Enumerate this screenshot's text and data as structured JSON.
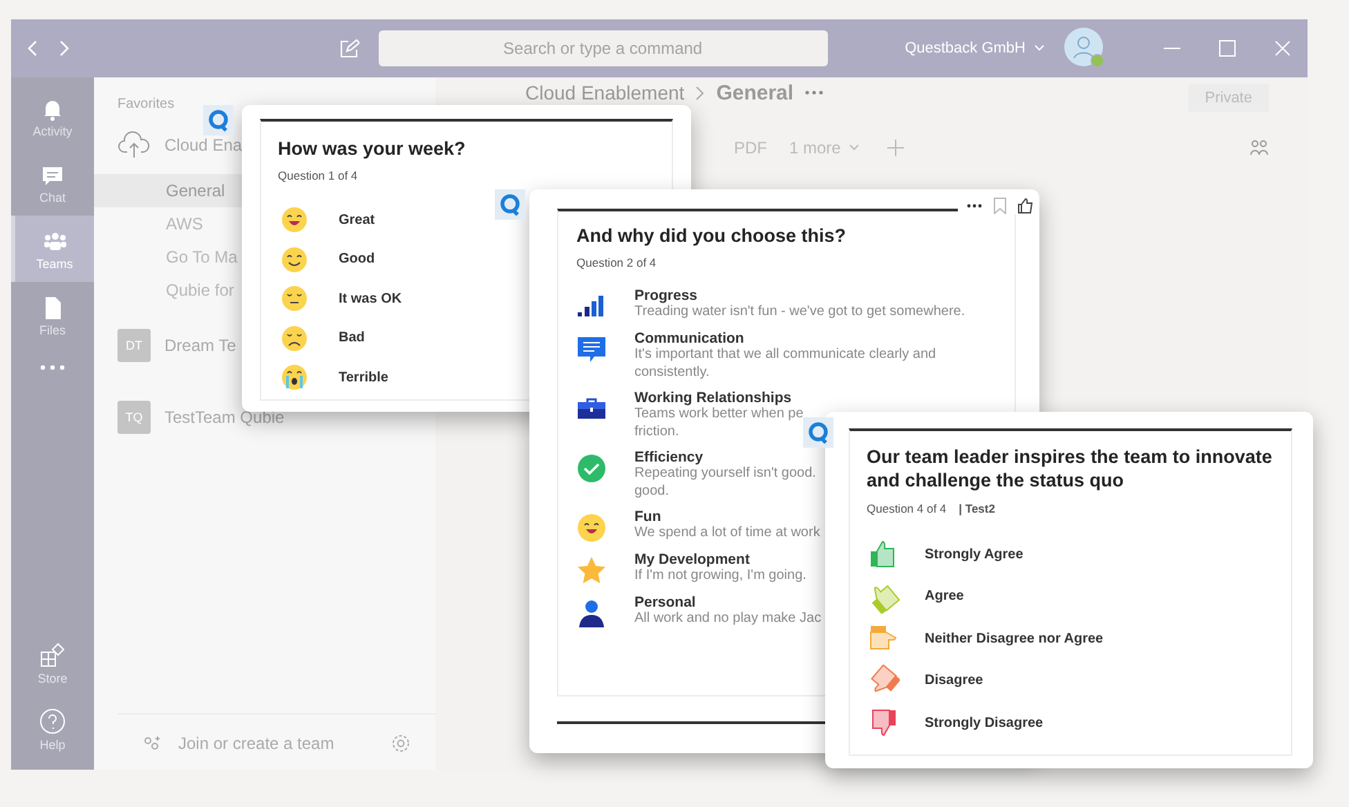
{
  "titlebar": {
    "search": {
      "placeholder": "Search or type a command"
    },
    "org": "Questback GmbH"
  },
  "rail": [
    {
      "label": "Activity",
      "kind": "bell",
      "selected": false
    },
    {
      "label": "Chat",
      "kind": "chat",
      "selected": false
    },
    {
      "label": "Teams",
      "kind": "teams",
      "selected": true
    },
    {
      "label": "Files",
      "kind": "file",
      "selected": false
    }
  ],
  "rail_bottom": [
    {
      "label": "Store",
      "kind": "store"
    },
    {
      "label": "Help",
      "kind": "help"
    }
  ],
  "sidebar": {
    "heading": "Favorites",
    "teams": [
      {
        "name": "Cloud Ena",
        "kind": "cloud",
        "channels": [
          {
            "name": "General",
            "selected": true
          },
          {
            "name": "AWS",
            "selected": false
          },
          {
            "name": "Go To Ma",
            "selected": false
          },
          {
            "name": "Qubie for",
            "selected": false
          }
        ]
      },
      {
        "name": "Dream Te",
        "kind": "initials",
        "initials": "DT"
      },
      {
        "name": "TestTeam Qubie",
        "kind": "initials",
        "initials": "TQ"
      }
    ],
    "join": "Join or create a team"
  },
  "channel": {
    "breadcrumb": [
      "Cloud Enablement",
      "General"
    ],
    "private": "Private",
    "tabs": [
      "PDF",
      "1 more"
    ]
  },
  "cards": [
    {
      "kind": "emoji",
      "title": "How was your week?",
      "subtitle": "Question 1 of 4",
      "options": [
        {
          "label": "Great",
          "kind": "great"
        },
        {
          "label": "Good",
          "kind": "good"
        },
        {
          "label": "It was OK",
          "kind": "ok"
        },
        {
          "label": "Bad",
          "kind": "bad"
        },
        {
          "label": "Terrible",
          "kind": "terrible"
        }
      ]
    },
    {
      "kind": "reasons",
      "title": "And why did you choose this?",
      "subtitle": "Question 2 of 4",
      "options": [
        {
          "label": "Progress",
          "kind": "bars",
          "lines": [
            "Treading water isn't fun - we've got to get somewhere."
          ]
        },
        {
          "label": "Communication",
          "kind": "message",
          "lines": [
            "It's important that we all communicate clearly and",
            "consistently."
          ]
        },
        {
          "label": "Working Relationships",
          "kind": "briefcase",
          "lines": [
            "Teams work better when pe",
            "friction."
          ]
        },
        {
          "label": "Efficiency",
          "kind": "check",
          "lines": [
            "Repeating yourself isn't good.",
            "good."
          ]
        },
        {
          "label": "Fun",
          "kind": "smile",
          "lines": [
            "We spend a lot of time at work"
          ]
        },
        {
          "label": "My Development",
          "kind": "star",
          "lines": [
            "If I'm not growing, I'm going."
          ]
        },
        {
          "label": "Personal",
          "kind": "person",
          "lines": [
            "All work and no play make Jac"
          ]
        }
      ]
    },
    {
      "kind": "scale",
      "title": "Our team leader inspires the team to innovate and challenge the status quo",
      "subtitle": "Question 4 of 4",
      "tag": "| Test2",
      "options": [
        {
          "label": "Strongly Agree",
          "kind": "up",
          "color": "#2fb55a"
        },
        {
          "label": "Agree",
          "kind": "up-tilt",
          "color": "#a9cc2a"
        },
        {
          "label": "Neither Disagree nor Agree",
          "kind": "side",
          "color": "#f5a93a"
        },
        {
          "label": "Disagree",
          "kind": "down-tilt",
          "color": "#f07b4f"
        },
        {
          "label": "Strongly Disagree",
          "kind": "down",
          "color": "#e9425a"
        }
      ]
    }
  ]
}
